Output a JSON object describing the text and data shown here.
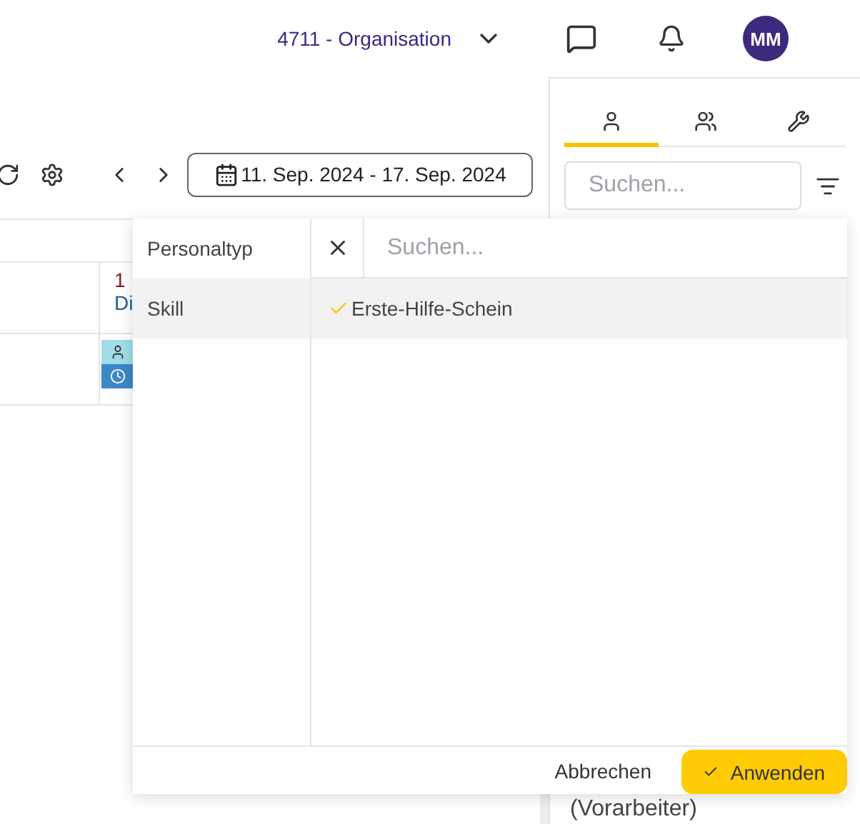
{
  "header": {
    "organisation": "4711 - Organisation",
    "avatar": "MM"
  },
  "toolbar": {
    "date_range": "11. Sep. 2024 - 17. Sep. 2024"
  },
  "schedule": {
    "day_number": "1",
    "day_name": "Di",
    "entries": [
      {
        "kind": "person",
        "color": "#a0dde6"
      },
      {
        "kind": "clock",
        "color": "#3d87c7"
      }
    ]
  },
  "panel": {
    "tabs": [
      {
        "kind": "person",
        "selected": true
      },
      {
        "kind": "group",
        "selected": false
      },
      {
        "kind": "wrench",
        "selected": false
      }
    ],
    "search": {
      "placeholder": "Suchen..."
    },
    "person_role": "(Vorarbeiter)"
  },
  "filter_popup": {
    "categories": [
      {
        "label": "Personaltyp",
        "selected": false
      },
      {
        "label": "Skill",
        "selected": true
      }
    ],
    "search": {
      "placeholder": "Suchen..."
    },
    "options": [
      {
        "label": "Erste-Hilfe-Schein",
        "checked": true
      }
    ],
    "cancel": "Abbrechen",
    "apply": "Anwenden"
  }
}
